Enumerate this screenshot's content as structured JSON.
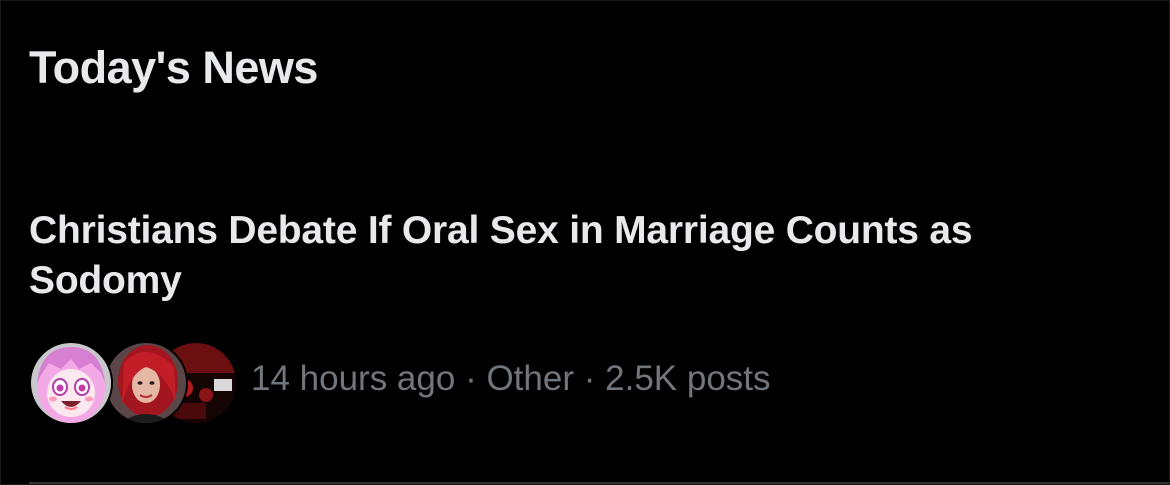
{
  "section": {
    "title": "Today's News"
  },
  "news_item": {
    "headline": "Christians Debate If Oral Sex in Marriage Counts as Sodomy",
    "time": "14 hours ago",
    "separator": "·",
    "category": "Other",
    "posts": "2.5K posts"
  },
  "avatars": [
    {
      "name": "anime-pink-hair-avatar-icon"
    },
    {
      "name": "red-hair-person-avatar-icon"
    },
    {
      "name": "dark-red-scene-avatar-icon"
    }
  ],
  "colors": {
    "background": "#000000",
    "primary_text": "#e7e9ea",
    "secondary_text": "#71767b",
    "divider": "#2f3336"
  }
}
